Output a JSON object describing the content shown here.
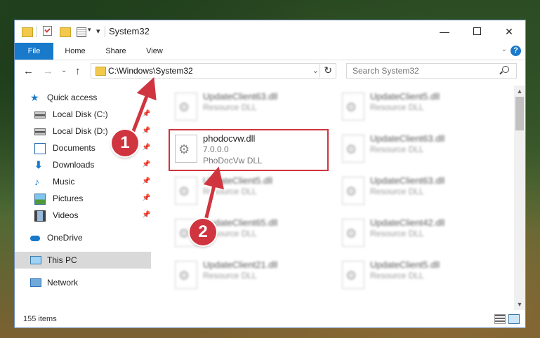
{
  "window": {
    "title": "System32",
    "controls": {
      "minimize": "—",
      "maximize": "",
      "close": "✕"
    }
  },
  "ribbon": {
    "tabs": [
      "File",
      "Home",
      "Share",
      "View"
    ],
    "collapse": "⌄",
    "help": "?"
  },
  "navbar": {
    "back": "←",
    "forward": "→",
    "history": "⌄",
    "up": "↑",
    "address": "C:\\Windows\\System32",
    "address_dropdown": "⌄",
    "refresh": "↻",
    "search_placeholder": "Search System32"
  },
  "sidebar": {
    "items": [
      {
        "label": "Quick access",
        "icon": "star-icon",
        "pinned": false
      },
      {
        "label": "Local Disk (C:)",
        "icon": "drive-icon",
        "pinned": true
      },
      {
        "label": "Local Disk (D:)",
        "icon": "drive-icon",
        "pinned": true
      },
      {
        "label": "Documents",
        "icon": "documents-icon",
        "pinned": true
      },
      {
        "label": "Downloads",
        "icon": "downloads-icon",
        "pinned": true
      },
      {
        "label": "Music",
        "icon": "music-icon",
        "pinned": true
      },
      {
        "label": "Pictures",
        "icon": "pictures-icon",
        "pinned": true
      },
      {
        "label": "Videos",
        "icon": "videos-icon",
        "pinned": true
      },
      {
        "label": "OneDrive",
        "icon": "onedrive-icon",
        "pinned": false
      },
      {
        "label": "This PC",
        "icon": "this-pc-icon",
        "pinned": false,
        "selected": true
      },
      {
        "label": "Network",
        "icon": "network-icon",
        "pinned": false
      }
    ],
    "pin_glyph": "📌"
  },
  "files": {
    "left": [
      {
        "name": "UpdateClient63.dll",
        "type": "Resource DLL",
        "blurred": true
      },
      {
        "name": "phodocvw.dll",
        "version": "7.0.0.0",
        "type": "PhoDocVw DLL",
        "blurred": false,
        "highlighted": true
      },
      {
        "name": "UpdateClient5.dll",
        "type": "Resource DLL",
        "blurred": true
      },
      {
        "name": "UpdateClient65.dll",
        "type": "Resource DLL",
        "blurred": true
      },
      {
        "name": "UpdateClient21.dll",
        "type": "Resource DLL",
        "blurred": true
      }
    ],
    "right": [
      {
        "name": "UpdateClient5.dll",
        "type": "Resource DLL",
        "blurred": true
      },
      {
        "name": "UpdateClient63.dll",
        "type": "Resource DLL",
        "blurred": true
      },
      {
        "name": "UpdateClient63.dll",
        "type": "Resource DLL",
        "blurred": true
      },
      {
        "name": "UpdateClient42.dll",
        "type": "Resource DLL",
        "blurred": true
      },
      {
        "name": "UpdateClient5.dll",
        "type": "Resource DLL",
        "blurred": true
      }
    ]
  },
  "scrollbar": {
    "up": "▲",
    "down": "▼"
  },
  "status": {
    "count": "155 items"
  },
  "annotations": {
    "step1": "1",
    "step2": "2",
    "color": "#d0353f"
  }
}
